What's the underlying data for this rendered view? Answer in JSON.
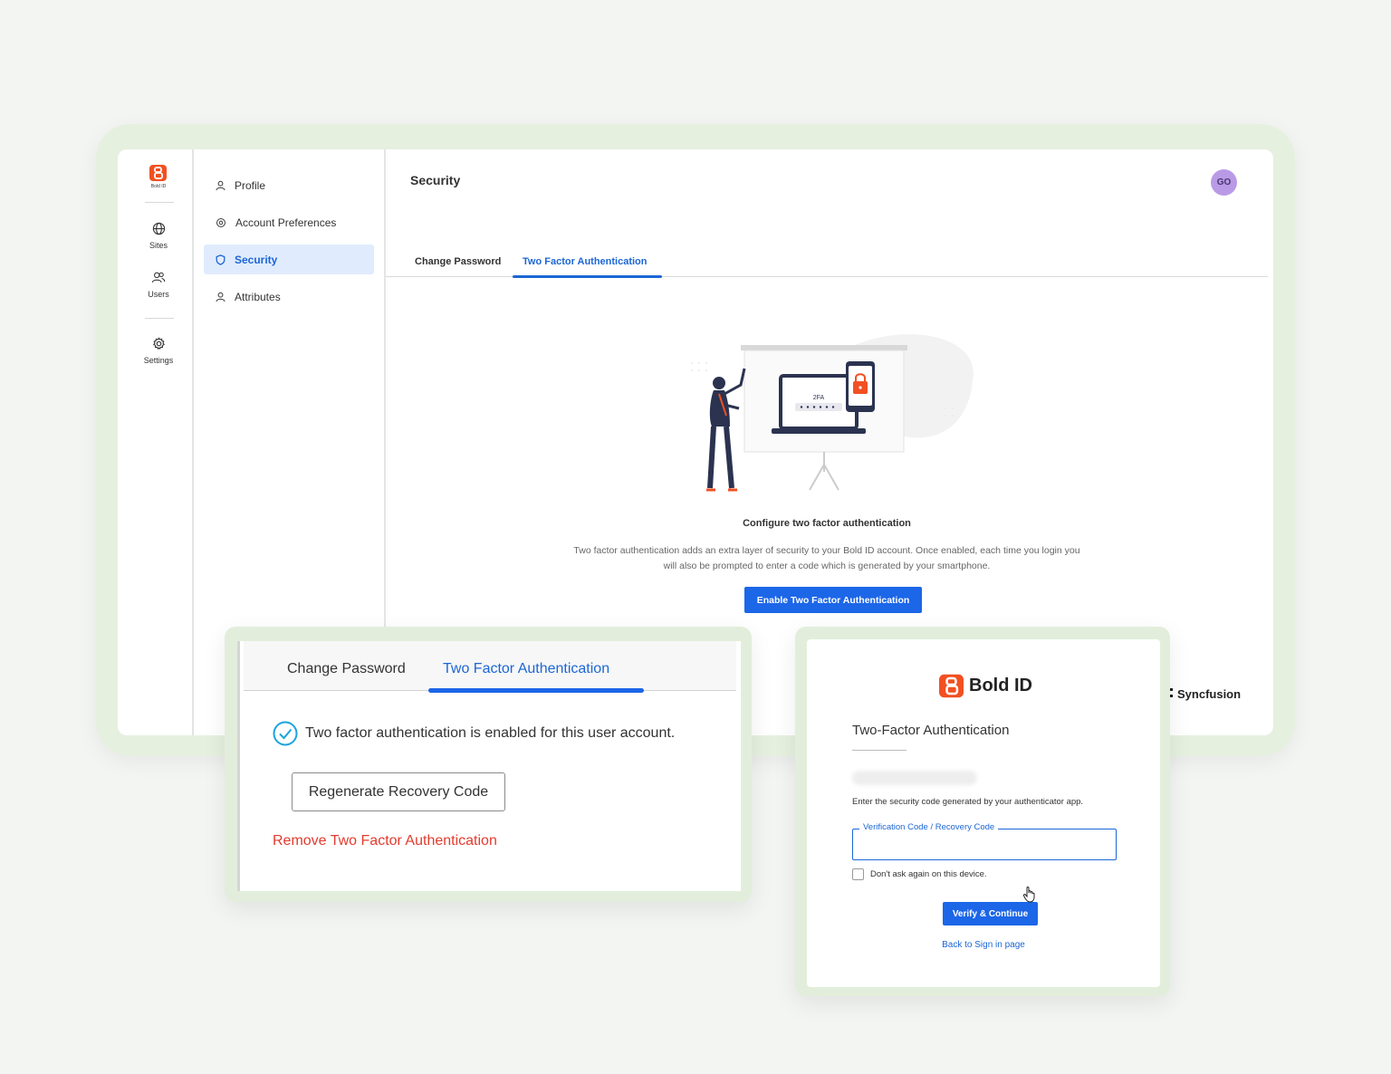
{
  "brand": {
    "logo_small_label": "Bold ID",
    "name": "Bold ID",
    "accent": "#f25022",
    "primary": "#1c66e8"
  },
  "rail": {
    "items": [
      {
        "label": "Sites",
        "icon": "globe-icon"
      },
      {
        "label": "Users",
        "icon": "users-icon"
      },
      {
        "label": "Settings",
        "icon": "gear-icon"
      }
    ]
  },
  "subnav": {
    "items": [
      {
        "label": "Profile",
        "icon": "person-icon"
      },
      {
        "label": "Account Preferences",
        "icon": "gear-icon"
      },
      {
        "label": "Security",
        "icon": "shield-icon",
        "active": true
      },
      {
        "label": "Attributes",
        "icon": "person-icon"
      }
    ]
  },
  "main": {
    "title": "Security",
    "avatar_initials": "GO",
    "tabs": [
      {
        "label": "Change Password"
      },
      {
        "label": "Two Factor Authentication",
        "active": true
      }
    ],
    "illustration_text": "2FA",
    "configure_title": "Configure two factor authentication",
    "configure_desc_line1": "Two factor authentication adds an extra layer of security to your Bold ID account. Once enabled, each time you login you",
    "configure_desc_line2": "will also be prompted to enter a code which is generated by your smartphone.",
    "enable_button": "Enable Two Factor Authentication",
    "footer_brand": "Syncfusion"
  },
  "enabled_card": {
    "tabs": [
      {
        "label": "Change Password"
      },
      {
        "label": "Two Factor Authentication",
        "active": true
      }
    ],
    "status_text": "Two factor authentication is enabled for this user account.",
    "regenerate_button": "Regenerate Recovery Code",
    "remove_link": "Remove Two Factor Authentication"
  },
  "login_card": {
    "brand": "Bold ID",
    "title": "Two-Factor Authentication",
    "hint": "Enter the security code generated by your authenticator app.",
    "field_label": "Verification Code / Recovery Code",
    "field_value": "",
    "remember_label": "Don't ask again on this device.",
    "remember_checked": false,
    "verify_button": "Verify & Continue",
    "back_link": "Back to Sign in page"
  }
}
